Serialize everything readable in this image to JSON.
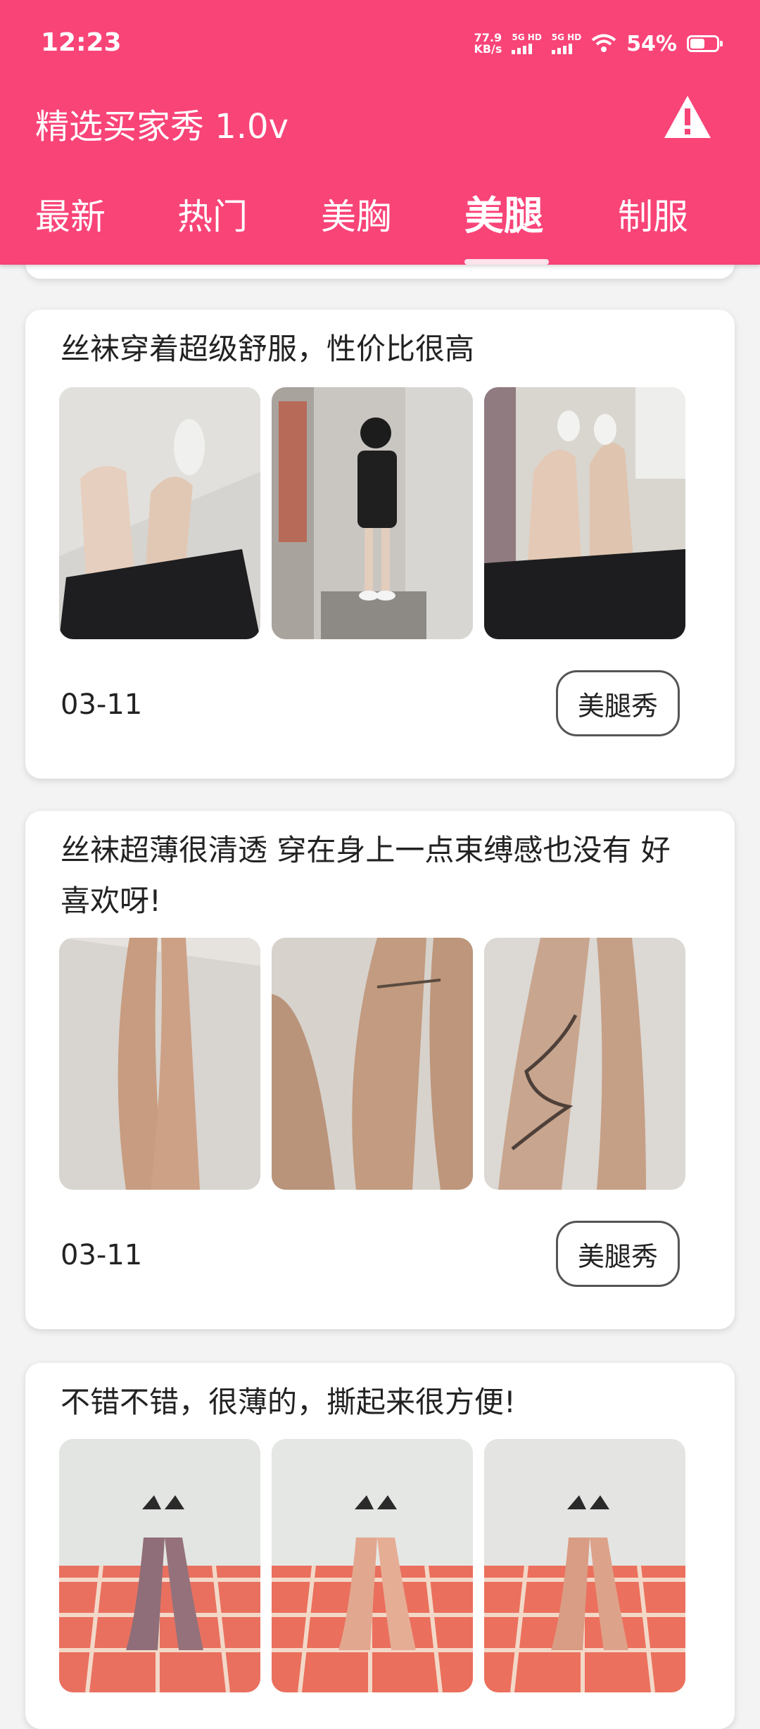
{
  "status_bar": {
    "time": "12:23",
    "net_speed_value": "77.9",
    "net_speed_unit": "KB/s",
    "sim1_label": "5G HD",
    "sim2_label": "5G HD",
    "battery": "54%"
  },
  "app": {
    "title": "精选买家秀 1.0v",
    "warning_icon": "warning-icon"
  },
  "tabs": [
    {
      "label": "最新",
      "active": false
    },
    {
      "label": "热门",
      "active": false
    },
    {
      "label": "美胸",
      "active": false
    },
    {
      "label": "美腿",
      "active": true
    },
    {
      "label": "制服",
      "active": false
    }
  ],
  "posts": [
    {
      "text": "丝袜穿着超级舒服，性价比很高",
      "date": "03-11",
      "tag": "美腿秀",
      "image_count": 3
    },
    {
      "text": "丝袜超薄很清透 穿在身上一点束缚感也没有 好喜欢呀!",
      "date": "03-11",
      "tag": "美腿秀",
      "image_count": 3
    },
    {
      "text": "不错不错，很薄的，撕起来很方便!",
      "image_count": 3
    }
  ],
  "colors": {
    "accent": "#f94478",
    "background": "#f3f3f3",
    "card": "#ffffff"
  }
}
